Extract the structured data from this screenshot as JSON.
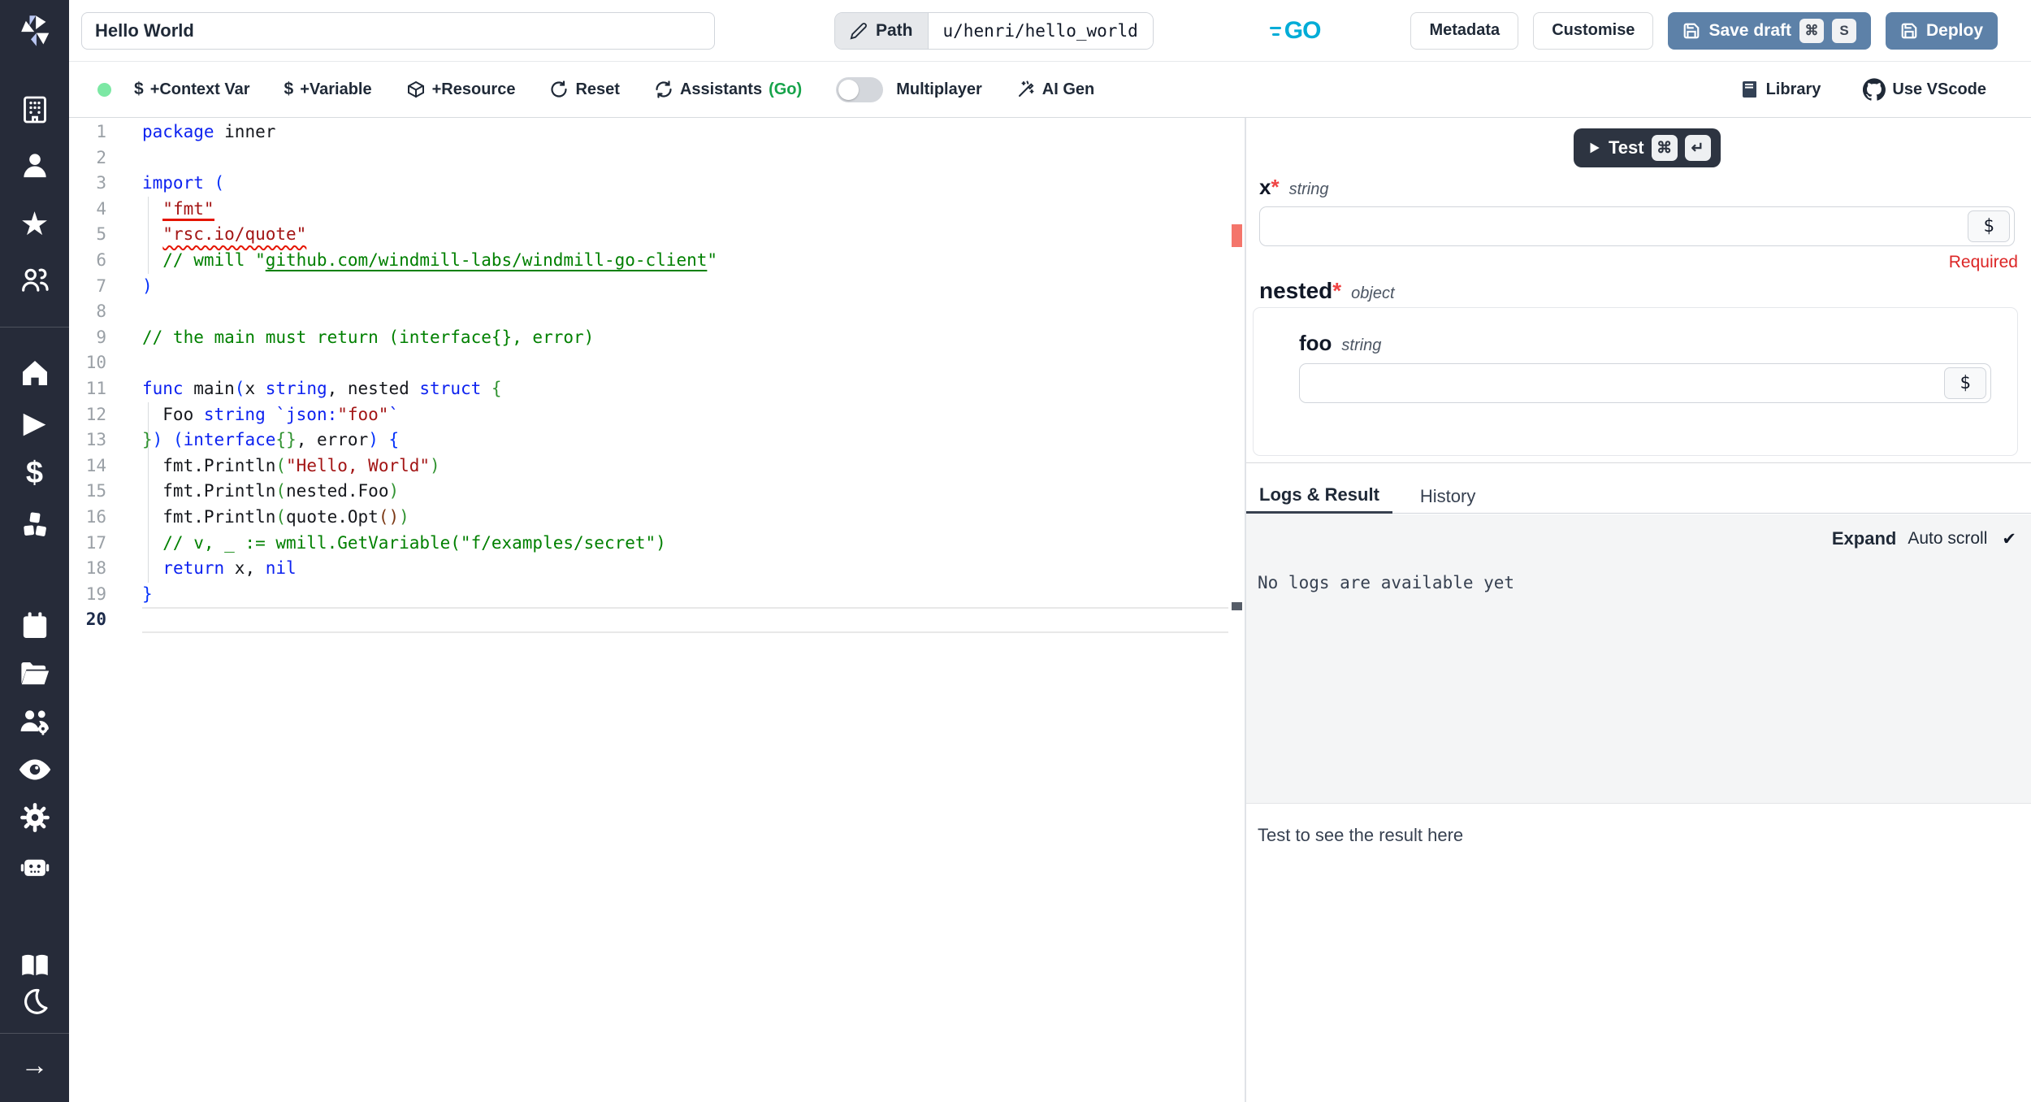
{
  "topbar": {
    "title_value": "Hello World",
    "path_label": "Path",
    "path_value": "u/henri/hello_world",
    "lang_badge": "GO",
    "metadata_label": "Metadata",
    "customise_label": "Customise",
    "save_draft_label": "Save draft",
    "save_kbd_mod": "⌘",
    "save_kbd_key": "S",
    "deploy_label": "Deploy"
  },
  "toolbar": {
    "status_dot_color": "#7ce8a4",
    "context_var_label": "+Context Var",
    "variable_label": "+Variable",
    "resource_label": "+Resource",
    "reset_label": "Reset",
    "assistants_label": "Assistants",
    "assistants_lang": "(Go)",
    "multiplayer_label": "Multiplayer",
    "ai_gen_label": "AI Gen",
    "library_label": "Library",
    "vscode_label": "Use VScode",
    "dollar_glyph": "$"
  },
  "sidebar": {
    "icons": [
      "windmill-logo",
      "building",
      "user",
      "star",
      "user-group",
      "home",
      "play",
      "dollar",
      "cubes",
      "calendar",
      "folder-open",
      "group-settings",
      "eye",
      "gear",
      "robot",
      "book-open",
      "moon",
      "arrow-right"
    ]
  },
  "editor": {
    "active_line": 20,
    "lines": [
      {
        "num": 1,
        "segs": [
          [
            "kw",
            "package"
          ],
          [
            "pl",
            " inner"
          ]
        ]
      },
      {
        "num": 2,
        "segs": []
      },
      {
        "num": 3,
        "segs": [
          [
            "kw",
            "import"
          ],
          [
            "pl",
            " "
          ],
          [
            "b1",
            "("
          ]
        ]
      },
      {
        "num": 4,
        "segs": [
          [
            "pl",
            "  "
          ],
          [
            "str err-solid",
            "\"fmt\""
          ]
        ]
      },
      {
        "num": 5,
        "segs": [
          [
            "pl",
            "  "
          ],
          [
            "str err-wavy",
            "\"rsc.io/quote\""
          ]
        ]
      },
      {
        "num": 6,
        "segs": [
          [
            "com",
            "// wmill \"",
            "  // wmill \""
          ],
          [
            "com link",
            "github.com/windmill-labs/windmill-go-client"
          ],
          [
            "com",
            "\""
          ]
        ]
      },
      {
        "num": 7,
        "segs": [
          [
            "b1",
            ")"
          ]
        ]
      },
      {
        "num": 8,
        "segs": []
      },
      {
        "num": 9,
        "segs": [
          [
            "com",
            "// the main must return (interface{}, error)"
          ]
        ]
      },
      {
        "num": 10,
        "segs": []
      },
      {
        "num": 11,
        "segs": [
          [
            "kw",
            "func"
          ],
          [
            "pl",
            " main"
          ],
          [
            "b1",
            "("
          ],
          [
            "pl",
            "x "
          ],
          [
            "kw",
            "string"
          ],
          [
            "pl",
            ", nested "
          ],
          [
            "kw",
            "struct"
          ],
          [
            "pl",
            " "
          ],
          [
            "b2",
            "{"
          ]
        ]
      },
      {
        "num": 12,
        "segs": [
          [
            "pl",
            "  Foo "
          ],
          [
            "kw",
            "string"
          ],
          [
            "pl",
            " "
          ],
          [
            "kw",
            "`json:"
          ],
          [
            "str",
            "\"foo\""
          ],
          [
            "kw",
            "`"
          ]
        ]
      },
      {
        "num": 13,
        "segs": [
          [
            "b2",
            "}"
          ],
          [
            "b1",
            ")"
          ],
          [
            "pl",
            " "
          ],
          [
            "b1",
            "("
          ],
          [
            "kw",
            "interface"
          ],
          [
            "b2",
            "{}"
          ],
          [
            "pl",
            ", error"
          ],
          [
            "b1",
            ")"
          ],
          [
            "pl",
            " "
          ],
          [
            "b1",
            "{"
          ]
        ]
      },
      {
        "num": 14,
        "segs": [
          [
            "pl",
            "  fmt.Println"
          ],
          [
            "b2",
            "("
          ],
          [
            "str",
            "\"Hello, World\""
          ],
          [
            "b2",
            ")"
          ]
        ]
      },
      {
        "num": 15,
        "segs": [
          [
            "pl",
            "  fmt.Println"
          ],
          [
            "b2",
            "("
          ],
          [
            "pl",
            "nested.Foo"
          ],
          [
            "b2",
            ")"
          ]
        ]
      },
      {
        "num": 16,
        "segs": [
          [
            "pl",
            "  fmt.Println"
          ],
          [
            "b2",
            "("
          ],
          [
            "pl",
            "quote.Opt"
          ],
          [
            "b3",
            "()"
          ],
          [
            "b2",
            ")"
          ]
        ]
      },
      {
        "num": 17,
        "segs": [
          [
            "com",
            "  // v, _ := wmill.GetVariable(\"f/examples/secret\")"
          ]
        ]
      },
      {
        "num": 18,
        "segs": [
          [
            "pl",
            "  "
          ],
          [
            "kw",
            "return"
          ],
          [
            "pl",
            " x, "
          ],
          [
            "kw",
            "nil"
          ]
        ]
      },
      {
        "num": 19,
        "segs": [
          [
            "b1",
            "}"
          ]
        ]
      },
      {
        "num": 20,
        "segs": []
      }
    ]
  },
  "panel": {
    "test_label": "Test",
    "test_kbd_mod": "⌘",
    "test_kbd_enter": "↵",
    "dollar": "$",
    "arg_x": {
      "name": "x",
      "required_mark": "*",
      "type": "string",
      "value": "",
      "error": "Required"
    },
    "arg_nested": {
      "name": "nested",
      "required_mark": "*",
      "type": "object"
    },
    "arg_foo": {
      "name": "foo",
      "type": "string",
      "value": ""
    },
    "tabs": {
      "logs": "Logs & Result",
      "history": "History"
    },
    "logs": {
      "expand_label": "Expand",
      "autoscroll_label": "Auto scroll",
      "autoscroll_check": "✔",
      "empty_message": "No logs are available yet"
    },
    "result": {
      "placeholder": "Test to see the result here"
    }
  }
}
